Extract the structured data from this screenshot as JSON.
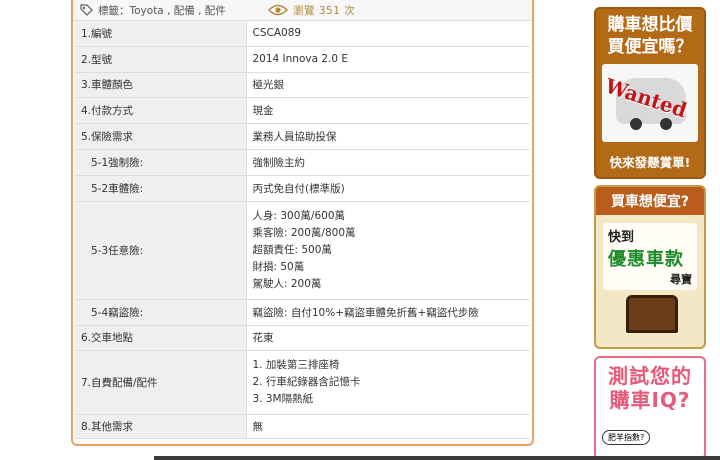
{
  "tags": {
    "label": "標籤：",
    "value": "Toyota , 配備 , 配件"
  },
  "views": {
    "label": "瀏覽",
    "count": "351",
    "unit": "次"
  },
  "rows": [
    {
      "key": "1.編號",
      "value": "CSCA089"
    },
    {
      "key": "2.型號",
      "value": "2014 Innova 2.0 E"
    },
    {
      "key": "3.車體顏色",
      "value": "極光銀"
    },
    {
      "key": "4.付款方式",
      "value": "現金"
    },
    {
      "key": "5.保險需求",
      "value": "業務人員協助投保"
    },
    {
      "key": "5-1強制險:",
      "value": "強制險主約"
    },
    {
      "key": "5-2車體險:",
      "value": "丙式免自付(標準版)"
    },
    {
      "key": "5-3任意險:",
      "lines": [
        "人身: 300萬/600萬",
        "乘客險: 200萬/800萬",
        "超額責任: 500萬",
        "財損: 50萬",
        "駕駛人: 200萬"
      ]
    },
    {
      "key": "5-4竊盜險:",
      "value": "竊盜險: 自付10%+竊盜車體免折舊+竊盜代步險"
    },
    {
      "key": "6.交車地點",
      "value": "花東"
    },
    {
      "key": "7.自費配備/配件",
      "lines": [
        "1. 加裝第三排座椅",
        "2. 行車紀錄器含記憶卡",
        "3. 3M隔熱紙"
      ]
    },
    {
      "key": "8.其他需求",
      "value": "無"
    }
  ],
  "ads": {
    "wanted": {
      "line1": "購車想比價",
      "line2": "買便宜嗎？",
      "stamp": "Wanted",
      "footer": "快來發懸賞單!"
    },
    "treasure": {
      "header": "買車想便宜?",
      "line1": "快到",
      "line2": "優惠車款",
      "line3": "尋寶"
    },
    "quiz": {
      "line1": "測試您的",
      "line2": "購車IQ?",
      "bubble": "肥羊指數?"
    }
  },
  "colors": {
    "panel_border": "#e8a063",
    "key_bg": "#efefef",
    "views_text": "#b28a3f"
  }
}
